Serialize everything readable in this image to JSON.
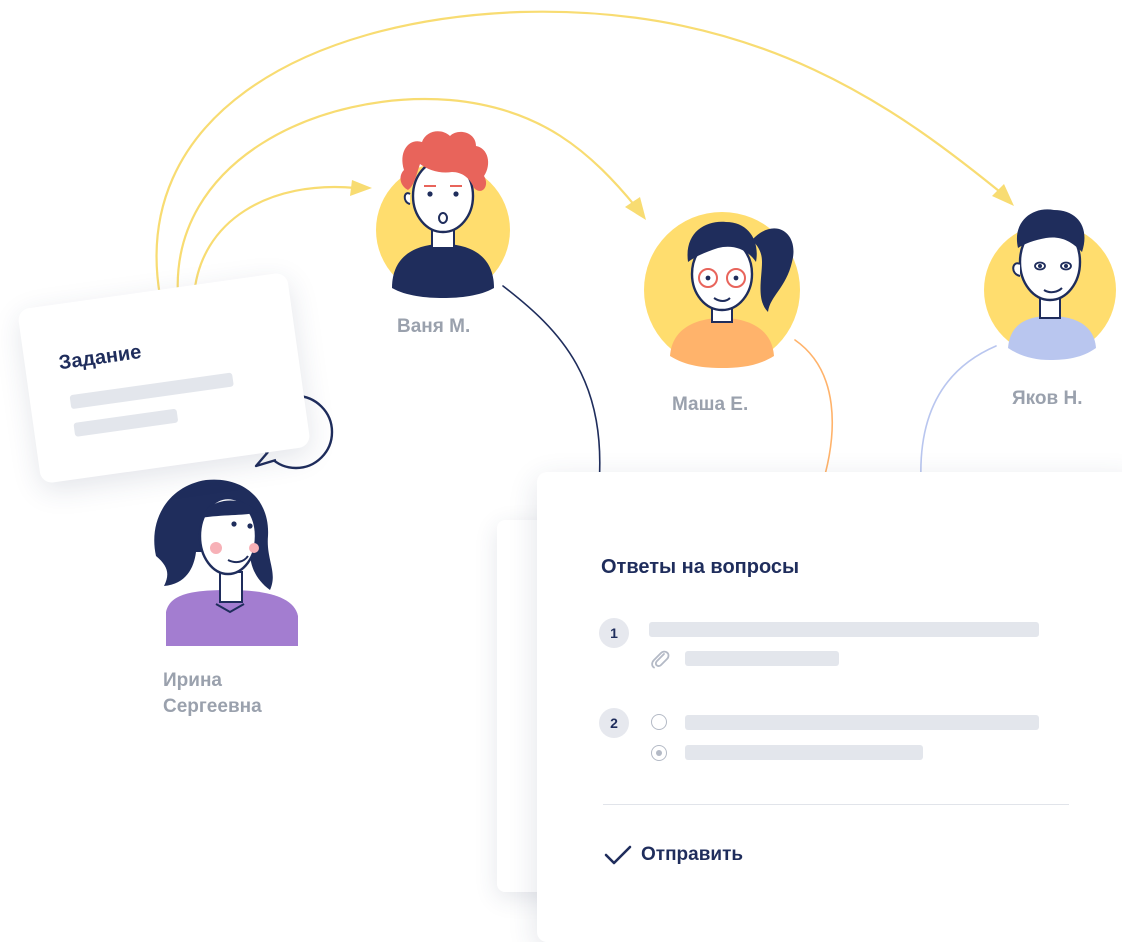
{
  "task_card": {
    "title": "Задание"
  },
  "people": [
    {
      "id": "teacher",
      "name": "Ирина",
      "name_line2": "Сергеевна"
    },
    {
      "id": "vanya",
      "name": "Ваня М."
    },
    {
      "id": "masha",
      "name": "Маша Е."
    },
    {
      "id": "yakov",
      "name": "Яков Н."
    }
  ],
  "speech_bubble": {
    "text": "?"
  },
  "answers_card": {
    "title": "Ответы на вопросы",
    "questions": [
      {
        "number": "1",
        "has_attachment": true
      },
      {
        "number": "2",
        "options": [
          {
            "selected": false
          },
          {
            "selected": true
          }
        ]
      }
    ],
    "submit_label": "Отправить"
  },
  "colors": {
    "navy": "#1f2d5c",
    "yellow": "#ffdd6e",
    "arrow_yellow": "#f8dc72",
    "orange": "#ffb36b",
    "lavender": "#b9c6ef",
    "purple": "#a37dd0",
    "red_hair": "#e8645b",
    "placeholder": "#e3e6ec",
    "muted_text": "#9aa1ad"
  }
}
